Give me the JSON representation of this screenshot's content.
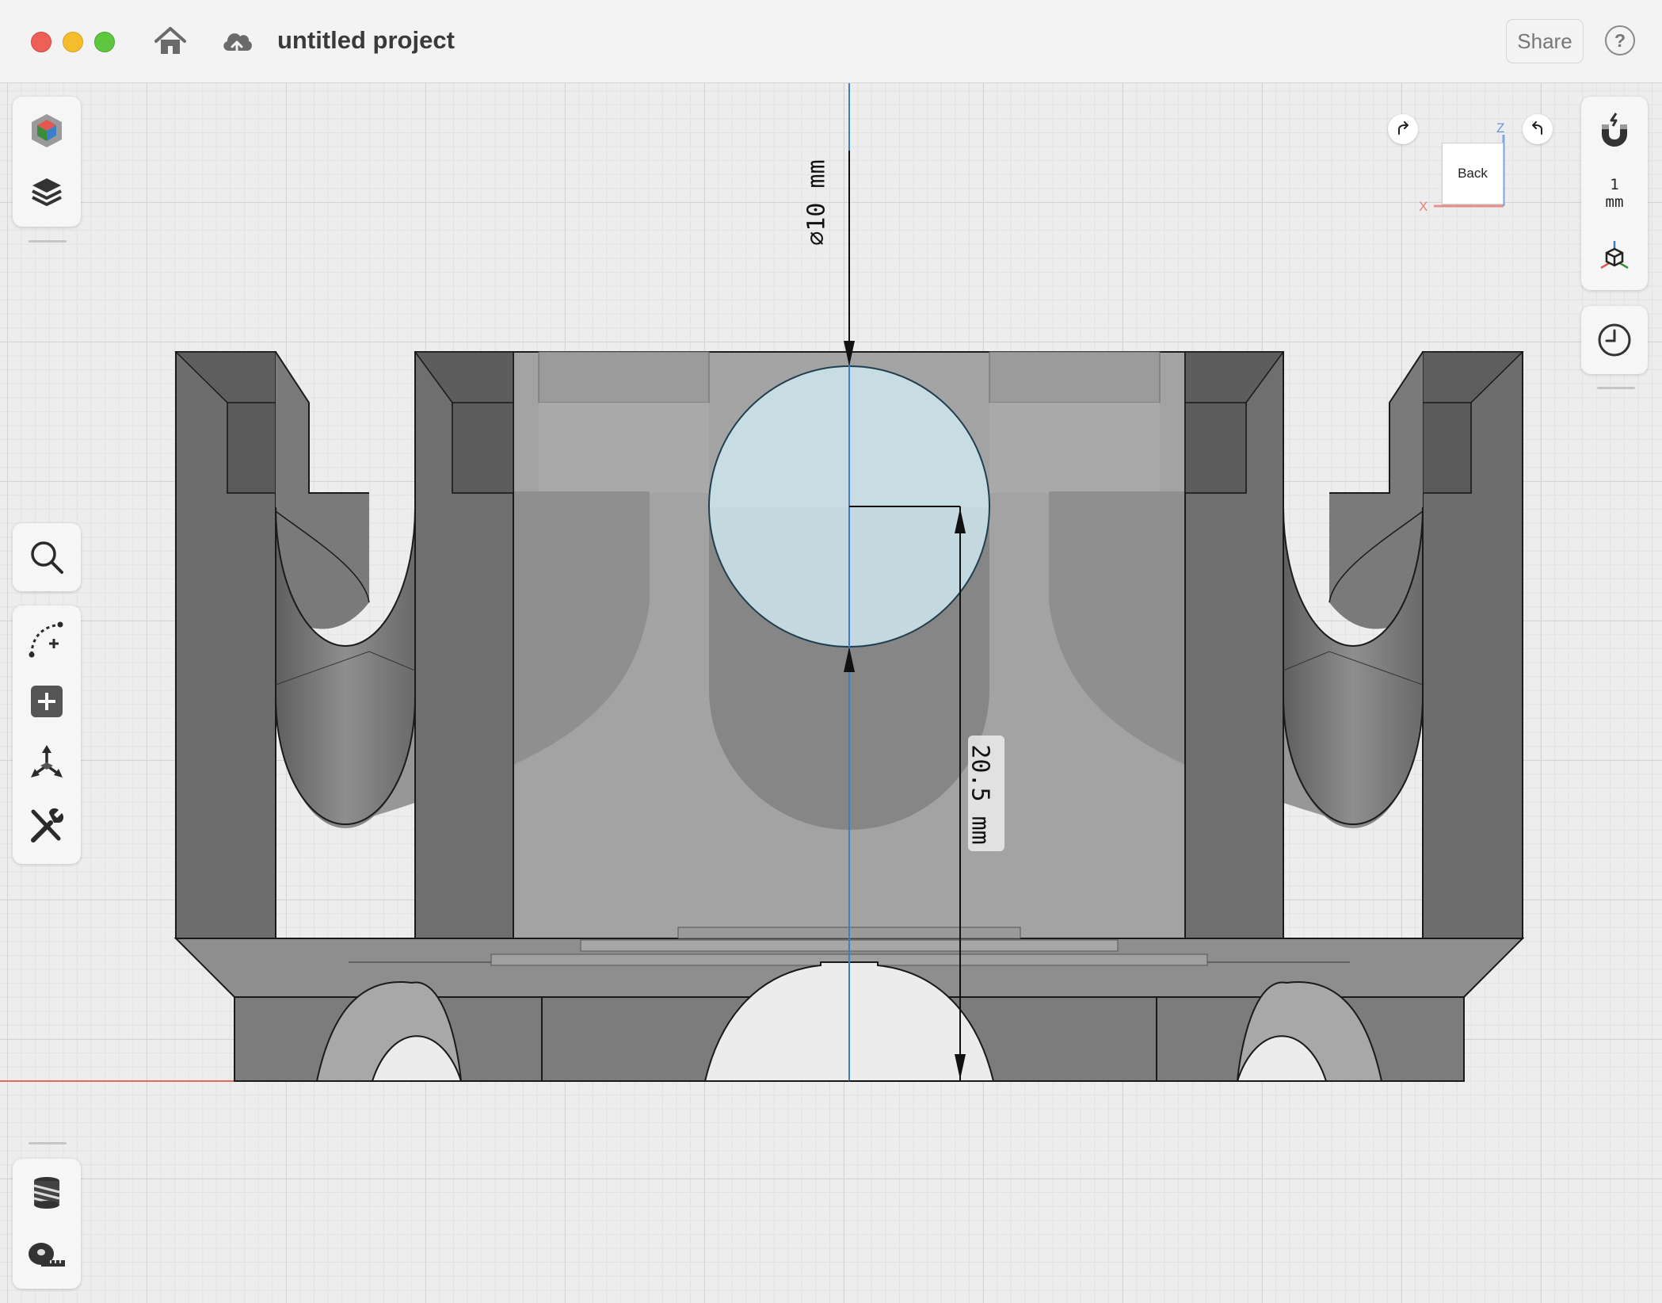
{
  "window": {
    "title": "untitled project",
    "controls": [
      "close",
      "minimize",
      "zoom"
    ]
  },
  "header": {
    "home_icon": "home-icon",
    "cloud_icon": "cloud-upload-icon",
    "share_label": "Share",
    "help_label": "?"
  },
  "left_toolbar": {
    "top_group": [
      "scene-cube-icon",
      "layers-icon"
    ],
    "middle_group": [
      "search-icon",
      "sketch-add-icon",
      "add-shape-icon",
      "transform-icon",
      "tools-icon"
    ],
    "bottom_group": [
      "thread-icon",
      "measure-tape-icon"
    ]
  },
  "right_toolbar": {
    "snap_icon": "magnet-icon",
    "snap_value": "1",
    "snap_unit": "mm",
    "view_icon": "axes-cube-icon",
    "history_icon": "clock-icon"
  },
  "view_cube": {
    "face_label": "Back",
    "axis_z": "Z",
    "axis_x": "X",
    "rotate_left_icon": "rotate-cw-icon",
    "rotate_right_icon": "rotate-ccw-icon"
  },
  "dimensions": {
    "diameter_label": "⌀10 mm",
    "height_label": "20.5 mm"
  },
  "colors": {
    "accent_selection": "#cfe6ef",
    "model_dark": "#6f6f6f",
    "model_mid": "#8a8a8a",
    "model_light": "#a8a8a8",
    "axis_red": "#e06a5f",
    "axis_blue": "#3d7ec8"
  }
}
